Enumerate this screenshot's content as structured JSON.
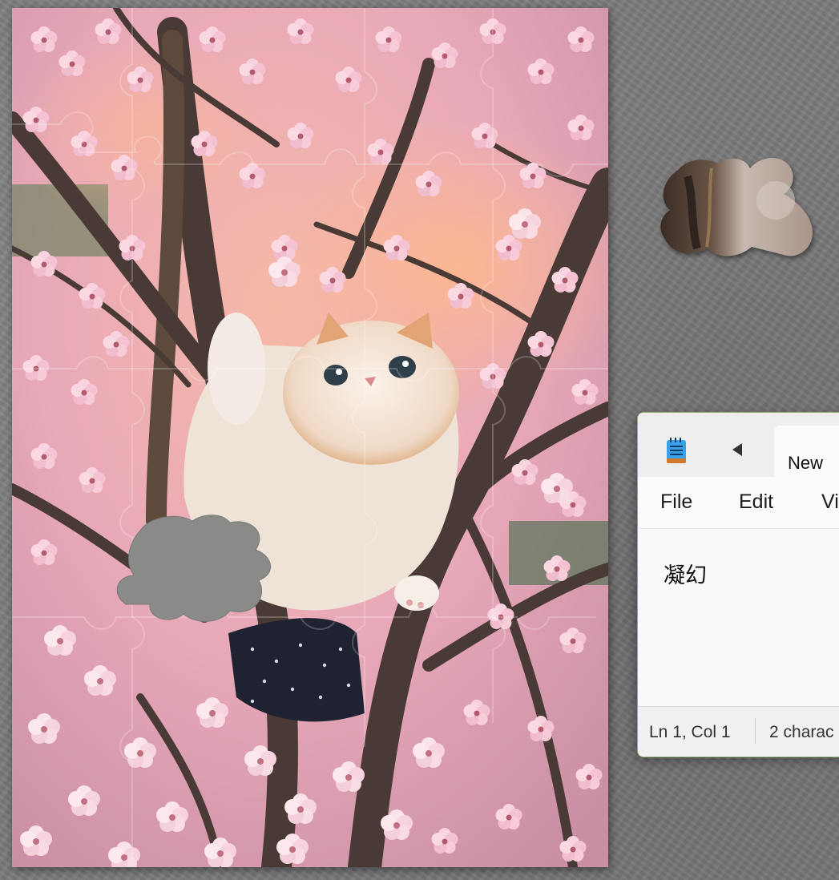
{
  "notepad": {
    "tab_title": "New",
    "menu": [
      "File",
      "Edit",
      "Vi"
    ],
    "document_text": "凝幻",
    "status_position": "Ln 1, Col 1",
    "status_chars": "2 charac"
  },
  "icons": {
    "app": "notepad-icon",
    "tab_nav": "triangle-left-icon"
  },
  "colors": {
    "desktop": "#7b7b7b",
    "window_border": "#8fae7c",
    "blossom": "#f4c6d6",
    "branch": "#4a3a36",
    "missing_slot": "#8a8a88"
  }
}
